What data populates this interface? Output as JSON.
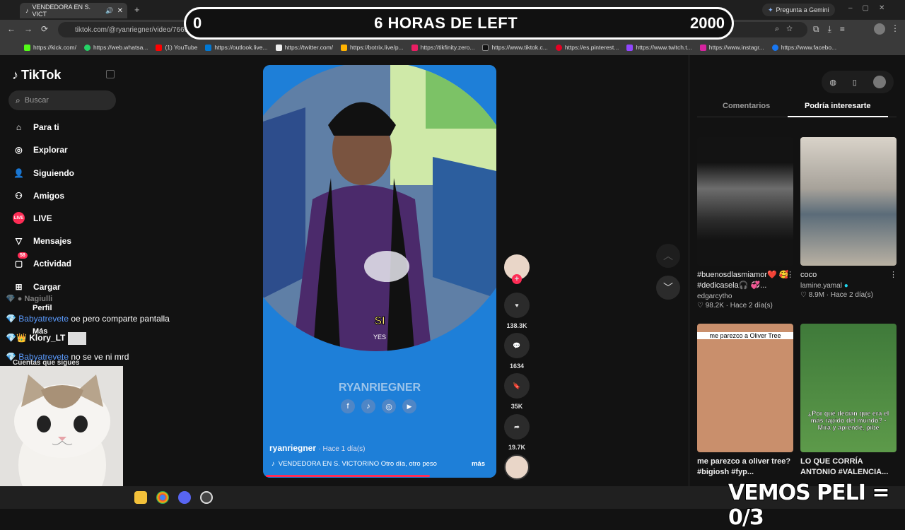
{
  "browser": {
    "tab_title": "VENDEDORA EN S. VICT",
    "url": "tiktok.com/@ryanriegner/video/766923…63217050893",
    "gemini_label": "Pregunta a Gemini",
    "bookmarks": [
      "https://kick.com/",
      "https://web.whatsa...",
      "(1) YouTube",
      "https://outlook.live...",
      "https://twitter.com/",
      "https://botrix.live/p...",
      "https://tikfinity.zero...",
      "https://www.tiktok.c...",
      "https://es.pinterest...",
      "https://www.twitch.t...",
      "https://www.instagr...",
      "https://www.facebo..."
    ]
  },
  "overlay": {
    "left_count": "0",
    "title": "6 HORAS DE LEFT",
    "right_count": "2000",
    "bottom_banner": "VEMOS PELI = 0/3"
  },
  "sidebar": {
    "logo": "TikTok",
    "search_placeholder": "Buscar",
    "items": [
      {
        "label": "Para ti",
        "icon": "home-icon"
      },
      {
        "label": "Explorar",
        "icon": "compass-icon"
      },
      {
        "label": "Siguiendo",
        "icon": "following-icon"
      },
      {
        "label": "Amigos",
        "icon": "friends-icon"
      },
      {
        "label": "LIVE",
        "icon": "live-icon"
      },
      {
        "label": "Mensajes",
        "icon": "messages-icon"
      },
      {
        "label": "Actividad",
        "icon": "activity-icon",
        "badge": "58"
      },
      {
        "label": "Cargar",
        "icon": "upload-icon"
      },
      {
        "label": "Perfil",
        "icon": "profile-icon"
      },
      {
        "label": "Más",
        "icon": "more-icon"
      }
    ],
    "following_heading": "Cuentas que sigues"
  },
  "chat": [
    {
      "user": "Nagiulli",
      "text": ""
    },
    {
      "user": "Babyatrevete",
      "text": "oe pero comparte pantalla"
    },
    {
      "user": "Klory_LT",
      "text": ""
    },
    {
      "user": "Babyatrevete",
      "text": "no se ve ni mrd"
    }
  ],
  "video": {
    "caption_word": "SI",
    "caption_sub": "YES",
    "watermark": "RYANRIEGNER",
    "author": "ryanriegner",
    "time_ago": "· Hace 1 día(s)",
    "description": "VENDEDORA EN S. VICTORINO Otro día, otro peso",
    "more": "más",
    "likes": "138.3K",
    "comments": "1634",
    "saves": "35K",
    "shares": "19.7K"
  },
  "right": {
    "tab_comments": "Comentarios",
    "tab_suggested": "Podría interesarte",
    "cards": [
      {
        "title": "#buenosdlasmiamor❤️ 🥰 #dedicasela🎧 💞...",
        "author": "edgarcytho",
        "likes": "98.2K",
        "time": "Hace 2 día(s)",
        "overlay": ""
      },
      {
        "title": "coco",
        "author": "lamine.yamal",
        "likes": "8.9M",
        "time": "Hace 2 día(s)",
        "overlay": ""
      },
      {
        "title": "me parezco a oliver tree? #bigiosh #fyp...",
        "author": "",
        "likes": "",
        "time": "",
        "overlay": "me parezco a Oliver Tree"
      },
      {
        "title": "LO QUE CORRÍA ANTONIO #VALENCIA...",
        "author": "",
        "likes": "",
        "time": "",
        "overlay": "¿Por qué decían que era el más rápido del mundo? -Mirá y aprendé, pibe"
      }
    ]
  },
  "colors": {
    "accent": "#fe2c55",
    "link": "#5a9bff",
    "verified": "#20d5ec"
  }
}
